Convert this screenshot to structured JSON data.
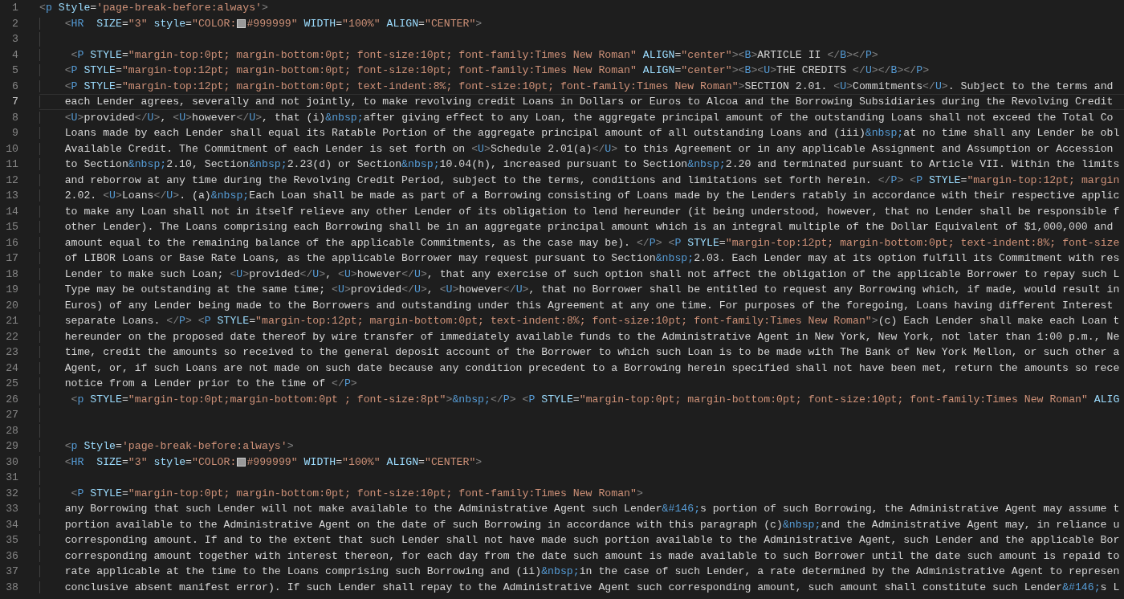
{
  "editor": {
    "lines": [
      {
        "number": "1",
        "current": false,
        "tokens": [
          {
            "kind": "bracket",
            "text": "<"
          },
          {
            "kind": "tag",
            "text": "p"
          },
          {
            "kind": "attr",
            "text": " Style"
          },
          {
            "kind": "eq",
            "text": "="
          },
          {
            "kind": "str",
            "text": "'page-break-before:always'"
          },
          {
            "kind": "bracket",
            "text": ">"
          }
        ]
      },
      {
        "number": "2",
        "current": false,
        "tokens": [
          {
            "kind": "bracket",
            "text": "    <"
          },
          {
            "kind": "tag",
            "text": "HR"
          },
          {
            "kind": "attr",
            "text": "  SIZE"
          },
          {
            "kind": "eq",
            "text": "="
          },
          {
            "kind": "str",
            "text": "\"3\""
          },
          {
            "kind": "attr",
            "text": " style"
          },
          {
            "kind": "eq",
            "text": "="
          },
          {
            "kind": "str",
            "text": "\"COLOR:"
          },
          {
            "kind": "swatch",
            "color": "#999999"
          },
          {
            "kind": "str",
            "text": "#999999\""
          },
          {
            "kind": "attr",
            "text": " WIDTH"
          },
          {
            "kind": "eq",
            "text": "="
          },
          {
            "kind": "str",
            "text": "\"100%\""
          },
          {
            "kind": "attr",
            "text": " ALIGN"
          },
          {
            "kind": "eq",
            "text": "="
          },
          {
            "kind": "str",
            "text": "\"CENTER\""
          },
          {
            "kind": "bracket",
            "text": ">"
          }
        ]
      },
      {
        "number": "3",
        "current": false
      },
      {
        "number": "4",
        "current": false,
        "tokens": [
          {
            "kind": "bracket",
            "text": "     <"
          },
          {
            "kind": "tag",
            "text": "P"
          },
          {
            "kind": "attr",
            "text": " STYLE"
          },
          {
            "kind": "eq",
            "text": "="
          },
          {
            "kind": "str",
            "text": "\"margin-top:0pt; margin-bottom:0pt; font-size:10pt; font-family:Times New Roman\""
          },
          {
            "kind": "attr",
            "text": " ALIGN"
          },
          {
            "kind": "eq",
            "text": "="
          },
          {
            "kind": "str",
            "text": "\"center\""
          },
          {
            "kind": "bracket",
            "text": "><"
          },
          {
            "kind": "tag",
            "text": "B"
          },
          {
            "kind": "bracket",
            "text": ">"
          },
          {
            "kind": "text",
            "text": "ARTICLE II "
          },
          {
            "kind": "bracket",
            "text": "</"
          },
          {
            "kind": "tag",
            "text": "B"
          },
          {
            "kind": "bracket",
            "text": "></"
          },
          {
            "kind": "tag",
            "text": "P"
          },
          {
            "kind": "bracket",
            "text": ">"
          }
        ]
      },
      {
        "number": "5",
        "current": false,
        "tokens": [
          {
            "kind": "bracket",
            "text": "    <"
          },
          {
            "kind": "tag",
            "text": "P"
          },
          {
            "kind": "attr",
            "text": " STYLE"
          },
          {
            "kind": "eq",
            "text": "="
          },
          {
            "kind": "str",
            "text": "\"margin-top:12pt; margin-bottom:0pt; font-size:10pt; font-family:Times New Roman\""
          },
          {
            "kind": "attr",
            "text": " ALIGN"
          },
          {
            "kind": "eq",
            "text": "="
          },
          {
            "kind": "str",
            "text": "\"center\""
          },
          {
            "kind": "bracket",
            "text": "><"
          },
          {
            "kind": "tag",
            "text": "B"
          },
          {
            "kind": "bracket",
            "text": "><"
          },
          {
            "kind": "tag",
            "text": "U"
          },
          {
            "kind": "bracket",
            "text": ">"
          },
          {
            "kind": "text",
            "text": "THE CREDITS "
          },
          {
            "kind": "bracket",
            "text": "</"
          },
          {
            "kind": "tag",
            "text": "U"
          },
          {
            "kind": "bracket",
            "text": "></"
          },
          {
            "kind": "tag",
            "text": "B"
          },
          {
            "kind": "bracket",
            "text": "></"
          },
          {
            "kind": "tag",
            "text": "P"
          },
          {
            "kind": "bracket",
            "text": ">"
          }
        ]
      },
      {
        "number": "6",
        "current": false,
        "tokens": [
          {
            "kind": "bracket",
            "text": "    <"
          },
          {
            "kind": "tag",
            "text": "P"
          },
          {
            "kind": "attr",
            "text": " STYLE"
          },
          {
            "kind": "eq",
            "text": "="
          },
          {
            "kind": "str",
            "text": "\"margin-top:12pt; margin-bottom:0pt; text-indent:8%; font-size:10pt; font-family:Times New Roman\""
          },
          {
            "kind": "bracket",
            "text": ">"
          },
          {
            "kind": "text",
            "text": "SECTION 2.01. "
          },
          {
            "kind": "bracket",
            "text": "<"
          },
          {
            "kind": "tag",
            "text": "U"
          },
          {
            "kind": "bracket",
            "text": ">"
          },
          {
            "kind": "text",
            "text": "Commitments"
          },
          {
            "kind": "bracket",
            "text": "</"
          },
          {
            "kind": "tag",
            "text": "U"
          },
          {
            "kind": "bracket",
            "text": ">"
          },
          {
            "kind": "text",
            "text": ". Subject to the terms and"
          }
        ]
      },
      {
        "number": "7",
        "current": true,
        "tokens": [
          {
            "kind": "text",
            "text": "    each Lender agrees, severally and not jointly, to make revolving credit Loans in Dollars or Euros to Alcoa and the Borrowing Subsidiaries during the Revolving Credit"
          }
        ]
      },
      {
        "number": "8",
        "current": false,
        "tokens": [
          {
            "kind": "bracket",
            "text": "    <"
          },
          {
            "kind": "tag",
            "text": "U"
          },
          {
            "kind": "bracket",
            "text": ">"
          },
          {
            "kind": "text",
            "text": "provided"
          },
          {
            "kind": "bracket",
            "text": "</"
          },
          {
            "kind": "tag",
            "text": "U"
          },
          {
            "kind": "bracket",
            "text": ">"
          },
          {
            "kind": "text",
            "text": ", "
          },
          {
            "kind": "bracket",
            "text": "<"
          },
          {
            "kind": "tag",
            "text": "U"
          },
          {
            "kind": "bracket",
            "text": ">"
          },
          {
            "kind": "text",
            "text": "however"
          },
          {
            "kind": "bracket",
            "text": "</"
          },
          {
            "kind": "tag",
            "text": "U"
          },
          {
            "kind": "bracket",
            "text": ">"
          },
          {
            "kind": "text",
            "text": ", that (i)"
          },
          {
            "kind": "entity",
            "text": "&nbsp;"
          },
          {
            "kind": "text",
            "text": "after giving effect to any Loan, the aggregate principal amount of the outstanding Loans shall not exceed the Total Co"
          }
        ]
      },
      {
        "number": "9",
        "current": false,
        "tokens": [
          {
            "kind": "text",
            "text": "    Loans made by each Lender shall equal its Ratable Portion of the aggregate principal amount of all outstanding Loans and (iii)"
          },
          {
            "kind": "entity",
            "text": "&nbsp;"
          },
          {
            "kind": "text",
            "text": "at no time shall any Lender be obl"
          }
        ]
      },
      {
        "number": "10",
        "current": false,
        "tokens": [
          {
            "kind": "text",
            "text": "    Available Credit. The Commitment of each Lender is set forth on "
          },
          {
            "kind": "bracket",
            "text": "<"
          },
          {
            "kind": "tag",
            "text": "U"
          },
          {
            "kind": "bracket",
            "text": ">"
          },
          {
            "kind": "text",
            "text": "Schedule 2.01(a)"
          },
          {
            "kind": "bracket",
            "text": "</"
          },
          {
            "kind": "tag",
            "text": "U"
          },
          {
            "kind": "bracket",
            "text": ">"
          },
          {
            "kind": "text",
            "text": " to this Agreement or in any applicable Assignment and Assumption or Accession"
          }
        ]
      },
      {
        "number": "11",
        "current": false,
        "tokens": [
          {
            "kind": "text",
            "text": "    to Section"
          },
          {
            "kind": "entity",
            "text": "&nbsp;"
          },
          {
            "kind": "text",
            "text": "2.10, Section"
          },
          {
            "kind": "entity",
            "text": "&nbsp;"
          },
          {
            "kind": "text",
            "text": "2.23(d) or Section"
          },
          {
            "kind": "entity",
            "text": "&nbsp;"
          },
          {
            "kind": "text",
            "text": "10.04(h), increased pursuant to Section"
          },
          {
            "kind": "entity",
            "text": "&nbsp;"
          },
          {
            "kind": "text",
            "text": "2.20 and terminated pursuant to Article VII. Within the limits"
          }
        ]
      },
      {
        "number": "12",
        "current": false,
        "tokens": [
          {
            "kind": "text",
            "text": "    and reborrow at any time during the Revolving Credit Period, subject to the terms, conditions and limitations set forth herein. "
          },
          {
            "kind": "bracket",
            "text": "</"
          },
          {
            "kind": "tag",
            "text": "P"
          },
          {
            "kind": "bracket",
            "text": "> <"
          },
          {
            "kind": "tag",
            "text": "P"
          },
          {
            "kind": "attr",
            "text": " STYLE"
          },
          {
            "kind": "eq",
            "text": "="
          },
          {
            "kind": "str",
            "text": "\"margin-top:12pt; margin"
          }
        ]
      },
      {
        "number": "13",
        "current": false,
        "tokens": [
          {
            "kind": "text",
            "text": "    2.02. "
          },
          {
            "kind": "bracket",
            "text": "<"
          },
          {
            "kind": "tag",
            "text": "U"
          },
          {
            "kind": "bracket",
            "text": ">"
          },
          {
            "kind": "text",
            "text": "Loans"
          },
          {
            "kind": "bracket",
            "text": "</"
          },
          {
            "kind": "tag",
            "text": "U"
          },
          {
            "kind": "bracket",
            "text": ">"
          },
          {
            "kind": "text",
            "text": ". (a)"
          },
          {
            "kind": "entity",
            "text": "&nbsp;"
          },
          {
            "kind": "text",
            "text": "Each Loan shall be made as part of a Borrowing consisting of Loans made by the Lenders ratably in accordance with their respective applic"
          }
        ]
      },
      {
        "number": "14",
        "current": false,
        "tokens": [
          {
            "kind": "text",
            "text": "    to make any Loan shall not in itself relieve any other Lender of its obligation to lend hereunder (it being understood, however, that no Lender shall be responsible f"
          }
        ]
      },
      {
        "number": "15",
        "current": false,
        "tokens": [
          {
            "kind": "text",
            "text": "    other Lender). The Loans comprising each Borrowing shall be in an aggregate principal amount which is an integral multiple of the Dollar Equivalent of $1,000,000 and"
          }
        ]
      },
      {
        "number": "16",
        "current": false,
        "tokens": [
          {
            "kind": "text",
            "text": "    amount equal to the remaining balance of the applicable Commitments, as the case may be). "
          },
          {
            "kind": "bracket",
            "text": "</"
          },
          {
            "kind": "tag",
            "text": "P"
          },
          {
            "kind": "bracket",
            "text": "> <"
          },
          {
            "kind": "tag",
            "text": "P"
          },
          {
            "kind": "attr",
            "text": " STYLE"
          },
          {
            "kind": "eq",
            "text": "="
          },
          {
            "kind": "str",
            "text": "\"margin-top:12pt; margin-bottom:0pt; text-indent:8%; font-size"
          }
        ]
      },
      {
        "number": "17",
        "current": false,
        "tokens": [
          {
            "kind": "text",
            "text": "    of LIBOR Loans or Base Rate Loans, as the applicable Borrower may request pursuant to Section"
          },
          {
            "kind": "entity",
            "text": "&nbsp;"
          },
          {
            "kind": "text",
            "text": "2.03. Each Lender may at its option fulfill its Commitment with res"
          }
        ]
      },
      {
        "number": "18",
        "current": false,
        "tokens": [
          {
            "kind": "text",
            "text": "    Lender to make such Loan; "
          },
          {
            "kind": "bracket",
            "text": "<"
          },
          {
            "kind": "tag",
            "text": "U"
          },
          {
            "kind": "bracket",
            "text": ">"
          },
          {
            "kind": "text",
            "text": "provided"
          },
          {
            "kind": "bracket",
            "text": "</"
          },
          {
            "kind": "tag",
            "text": "U"
          },
          {
            "kind": "bracket",
            "text": ">"
          },
          {
            "kind": "text",
            "text": ", "
          },
          {
            "kind": "bracket",
            "text": "<"
          },
          {
            "kind": "tag",
            "text": "U"
          },
          {
            "kind": "bracket",
            "text": ">"
          },
          {
            "kind": "text",
            "text": "however"
          },
          {
            "kind": "bracket",
            "text": "</"
          },
          {
            "kind": "tag",
            "text": "U"
          },
          {
            "kind": "bracket",
            "text": ">"
          },
          {
            "kind": "text",
            "text": ", that any exercise of such option shall not affect the obligation of the applicable Borrower to repay such L"
          }
        ]
      },
      {
        "number": "19",
        "current": false,
        "tokens": [
          {
            "kind": "text",
            "text": "    Type may be outstanding at the same time; "
          },
          {
            "kind": "bracket",
            "text": "<"
          },
          {
            "kind": "tag",
            "text": "U"
          },
          {
            "kind": "bracket",
            "text": ">"
          },
          {
            "kind": "text",
            "text": "provided"
          },
          {
            "kind": "bracket",
            "text": "</"
          },
          {
            "kind": "tag",
            "text": "U"
          },
          {
            "kind": "bracket",
            "text": ">"
          },
          {
            "kind": "text",
            "text": ", "
          },
          {
            "kind": "bracket",
            "text": "<"
          },
          {
            "kind": "tag",
            "text": "U"
          },
          {
            "kind": "bracket",
            "text": ">"
          },
          {
            "kind": "text",
            "text": "however"
          },
          {
            "kind": "bracket",
            "text": "</"
          },
          {
            "kind": "tag",
            "text": "U"
          },
          {
            "kind": "bracket",
            "text": ">"
          },
          {
            "kind": "text",
            "text": ", that no Borrower shall be entitled to request any Borrowing which, if made, would result in"
          }
        ]
      },
      {
        "number": "20",
        "current": false,
        "tokens": [
          {
            "kind": "text",
            "text": "    Euros) of any Lender being made to the Borrowers and outstanding under this Agreement at any one time. For purposes of the foregoing, Loans having different Interest"
          }
        ]
      },
      {
        "number": "21",
        "current": false,
        "tokens": [
          {
            "kind": "text",
            "text": "    separate Loans. "
          },
          {
            "kind": "bracket",
            "text": "</"
          },
          {
            "kind": "tag",
            "text": "P"
          },
          {
            "kind": "bracket",
            "text": "> <"
          },
          {
            "kind": "tag",
            "text": "P"
          },
          {
            "kind": "attr",
            "text": " STYLE"
          },
          {
            "kind": "eq",
            "text": "="
          },
          {
            "kind": "str",
            "text": "\"margin-top:12pt; margin-bottom:0pt; text-indent:8%; font-size:10pt; font-family:Times New Roman\""
          },
          {
            "kind": "bracket",
            "text": ">"
          },
          {
            "kind": "text",
            "text": "(c) Each Lender shall make each Loan t"
          }
        ]
      },
      {
        "number": "22",
        "current": false,
        "tokens": [
          {
            "kind": "text",
            "text": "    hereunder on the proposed date thereof by wire transfer of immediately available funds to the Administrative Agent in New York, New York, not later than 1:00 p.m., Ne"
          }
        ]
      },
      {
        "number": "23",
        "current": false,
        "tokens": [
          {
            "kind": "text",
            "text": "    time, credit the amounts so received to the general deposit account of the Borrower to which such Loan is to be made with The Bank of New York Mellon, or such other a"
          }
        ]
      },
      {
        "number": "24",
        "current": false,
        "tokens": [
          {
            "kind": "text",
            "text": "    Agent, or, if such Loans are not made on such date because any condition precedent to a Borrowing herein specified shall not have been met, return the amounts so rece"
          }
        ]
      },
      {
        "number": "25",
        "current": false,
        "tokens": [
          {
            "kind": "text",
            "text": "    notice from a Lender prior to the time of "
          },
          {
            "kind": "bracket",
            "text": "</"
          },
          {
            "kind": "tag",
            "text": "P"
          },
          {
            "kind": "bracket",
            "text": ">"
          }
        ]
      },
      {
        "number": "26",
        "current": false,
        "tokens": [
          {
            "kind": "bracket",
            "text": "     <"
          },
          {
            "kind": "tag",
            "text": "p"
          },
          {
            "kind": "attr",
            "text": " STYLE"
          },
          {
            "kind": "eq",
            "text": "="
          },
          {
            "kind": "str",
            "text": "\"margin-top:0pt;margin-bottom:0pt ; font-size:8pt\""
          },
          {
            "kind": "bracket",
            "text": ">"
          },
          {
            "kind": "entity",
            "text": "&nbsp;"
          },
          {
            "kind": "bracket",
            "text": "</"
          },
          {
            "kind": "tag",
            "text": "P"
          },
          {
            "kind": "bracket",
            "text": "> <"
          },
          {
            "kind": "tag",
            "text": "P"
          },
          {
            "kind": "attr",
            "text": " STYLE"
          },
          {
            "kind": "eq",
            "text": "="
          },
          {
            "kind": "str",
            "text": "\"margin-top:0pt; margin-bottom:0pt; font-size:10pt; font-family:Times New Roman\""
          },
          {
            "kind": "attr",
            "text": " ALIG"
          }
        ]
      },
      {
        "number": "27",
        "current": false
      },
      {
        "number": "28",
        "current": false
      },
      {
        "number": "29",
        "current": false,
        "tokens": [
          {
            "kind": "bracket",
            "text": "    <"
          },
          {
            "kind": "tag",
            "text": "p"
          },
          {
            "kind": "attr",
            "text": " Style"
          },
          {
            "kind": "eq",
            "text": "="
          },
          {
            "kind": "str",
            "text": "'page-break-before:always'"
          },
          {
            "kind": "bracket",
            "text": ">"
          }
        ]
      },
      {
        "number": "30",
        "current": false,
        "tokens": [
          {
            "kind": "bracket",
            "text": "    <"
          },
          {
            "kind": "tag",
            "text": "HR"
          },
          {
            "kind": "attr",
            "text": "  SIZE"
          },
          {
            "kind": "eq",
            "text": "="
          },
          {
            "kind": "str",
            "text": "\"3\""
          },
          {
            "kind": "attr",
            "text": " style"
          },
          {
            "kind": "eq",
            "text": "="
          },
          {
            "kind": "str",
            "text": "\"COLOR:"
          },
          {
            "kind": "swatch",
            "color": "#999999"
          },
          {
            "kind": "str",
            "text": "#999999\""
          },
          {
            "kind": "attr",
            "text": " WIDTH"
          },
          {
            "kind": "eq",
            "text": "="
          },
          {
            "kind": "str",
            "text": "\"100%\""
          },
          {
            "kind": "attr",
            "text": " ALIGN"
          },
          {
            "kind": "eq",
            "text": "="
          },
          {
            "kind": "str",
            "text": "\"CENTER\""
          },
          {
            "kind": "bracket",
            "text": ">"
          }
        ]
      },
      {
        "number": "31",
        "current": false
      },
      {
        "number": "32",
        "current": false,
        "tokens": [
          {
            "kind": "bracket",
            "text": "     <"
          },
          {
            "kind": "tag",
            "text": "P"
          },
          {
            "kind": "attr",
            "text": " STYLE"
          },
          {
            "kind": "eq",
            "text": "="
          },
          {
            "kind": "str",
            "text": "\"margin-top:0pt; margin-bottom:0pt; font-size:10pt; font-family:Times New Roman\""
          },
          {
            "kind": "bracket",
            "text": ">"
          }
        ]
      },
      {
        "number": "33",
        "current": false,
        "tokens": [
          {
            "kind": "text",
            "text": "    any Borrowing that such Lender will not make available to the Administrative Agent such Lender"
          },
          {
            "kind": "entity",
            "text": "&#146;"
          },
          {
            "kind": "text",
            "text": "s portion of such Borrowing, the Administrative Agent may assume t"
          }
        ]
      },
      {
        "number": "34",
        "current": false,
        "tokens": [
          {
            "kind": "text",
            "text": "    portion available to the Administrative Agent on the date of such Borrowing in accordance with this paragraph (c)"
          },
          {
            "kind": "entity",
            "text": "&nbsp;"
          },
          {
            "kind": "text",
            "text": "and the Administrative Agent may, in reliance u"
          }
        ]
      },
      {
        "number": "35",
        "current": false,
        "tokens": [
          {
            "kind": "text",
            "text": "    corresponding amount. If and to the extent that such Lender shall not have made such portion available to the Administrative Agent, such Lender and the applicable Bor"
          }
        ]
      },
      {
        "number": "36",
        "current": false,
        "tokens": [
          {
            "kind": "text",
            "text": "    corresponding amount together with interest thereon, for each day from the date such amount is made available to such Borrower until the date such amount is repaid to"
          }
        ]
      },
      {
        "number": "37",
        "current": false,
        "tokens": [
          {
            "kind": "text",
            "text": "    rate applicable at the time to the Loans comprising such Borrowing and (ii)"
          },
          {
            "kind": "entity",
            "text": "&nbsp;"
          },
          {
            "kind": "text",
            "text": "in the case of such Lender, a rate determined by the Administrative Agent to represen"
          }
        ]
      },
      {
        "number": "38",
        "current": false,
        "tokens": [
          {
            "kind": "text",
            "text": "    conclusive absent manifest error). If such Lender shall repay to the Administrative Agent such corresponding amount, such amount shall constitute such Lender"
          },
          {
            "kind": "entity",
            "text": "&#146;"
          },
          {
            "kind": "text",
            "text": "s L"
          }
        ]
      }
    ]
  }
}
